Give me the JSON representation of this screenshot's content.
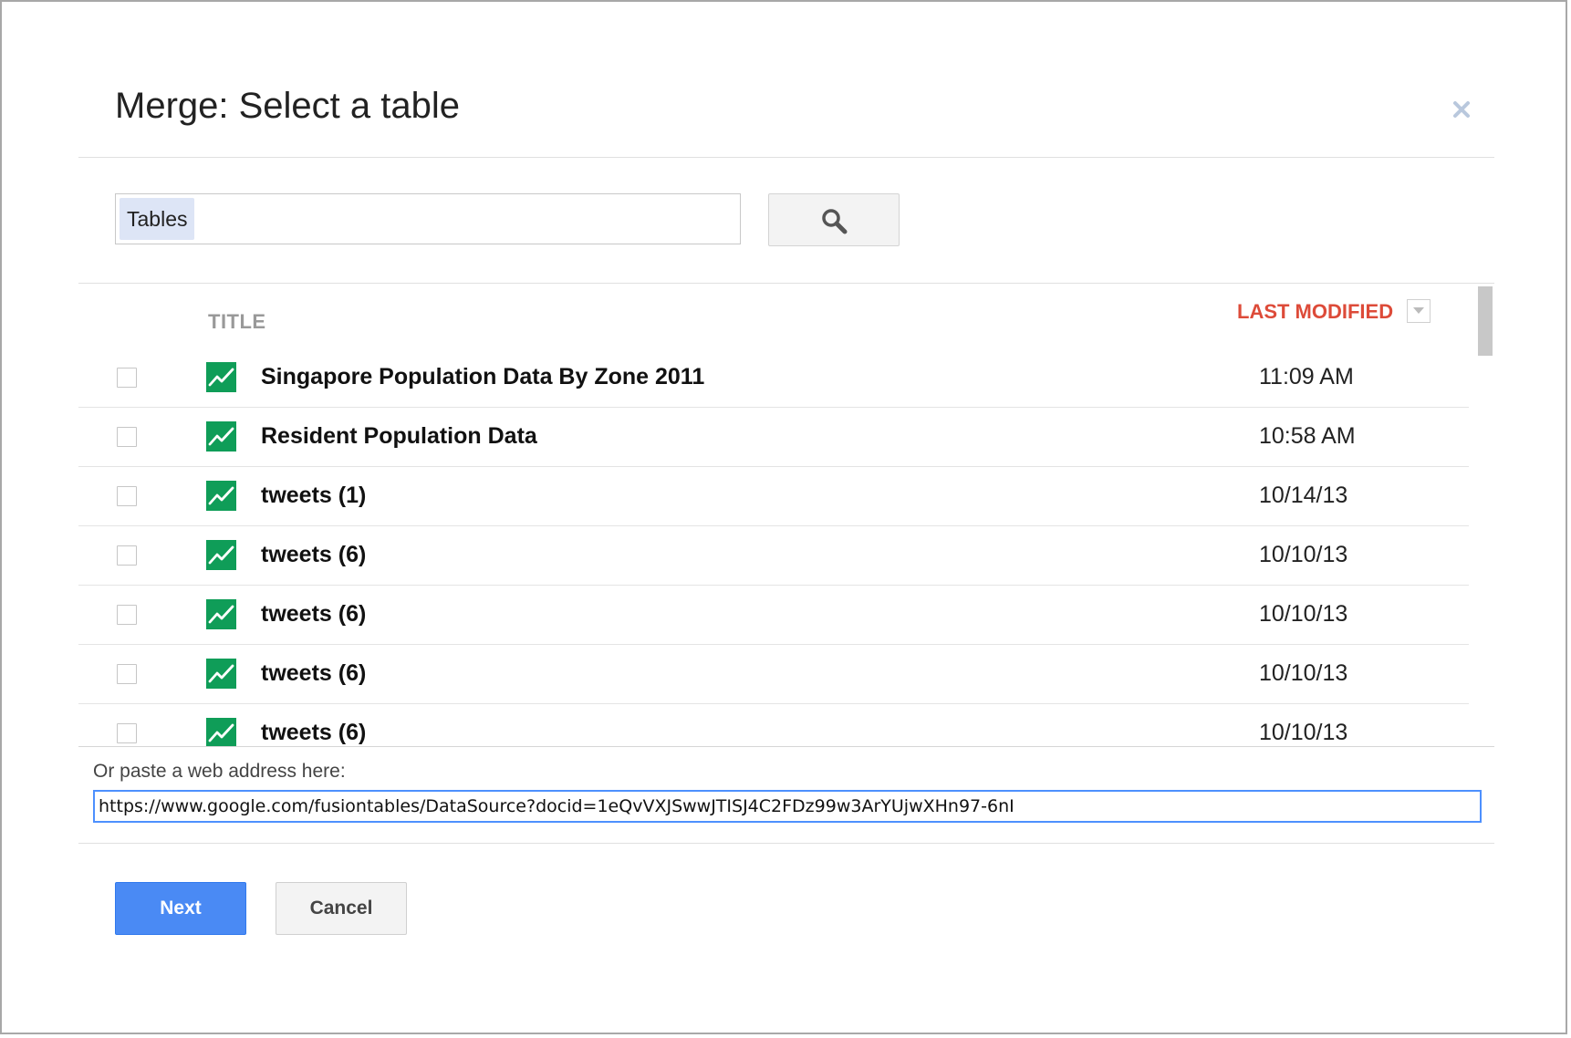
{
  "dialog": {
    "title": "Merge: Select a table",
    "close_icon": "close-icon"
  },
  "search": {
    "chip_label": "Tables",
    "button_icon": "search-icon"
  },
  "table": {
    "columns": {
      "title": "TITLE",
      "last_modified": "LAST MODIFIED"
    },
    "sort_icon": "chevron-down-icon",
    "row_icon": "table-chart-icon",
    "rows": [
      {
        "title": "Singapore Population Data By Zone 2011",
        "modified": "11:09 AM"
      },
      {
        "title": "Resident Population Data",
        "modified": "10:58 AM"
      },
      {
        "title": "tweets (1)",
        "modified": "10/14/13"
      },
      {
        "title": "tweets (6)",
        "modified": "10/10/13"
      },
      {
        "title": "tweets (6)",
        "modified": "10/10/13"
      },
      {
        "title": "tweets (6)",
        "modified": "10/10/13"
      },
      {
        "title": "tweets (6)",
        "modified": "10/10/13"
      }
    ]
  },
  "paste": {
    "label": "Or paste a web address here:",
    "value": "https://www.google.com/fusiontables/DataSource?docid=1eQvVXJSwwJTISJ4C2FDz99w3ArYUjwXHn97-6nI"
  },
  "footer": {
    "next_label": "Next",
    "cancel_label": "Cancel"
  },
  "colors": {
    "accent_blue": "#4a8af4",
    "sort_red": "#dd4b39",
    "icon_green": "#0f9d58"
  }
}
